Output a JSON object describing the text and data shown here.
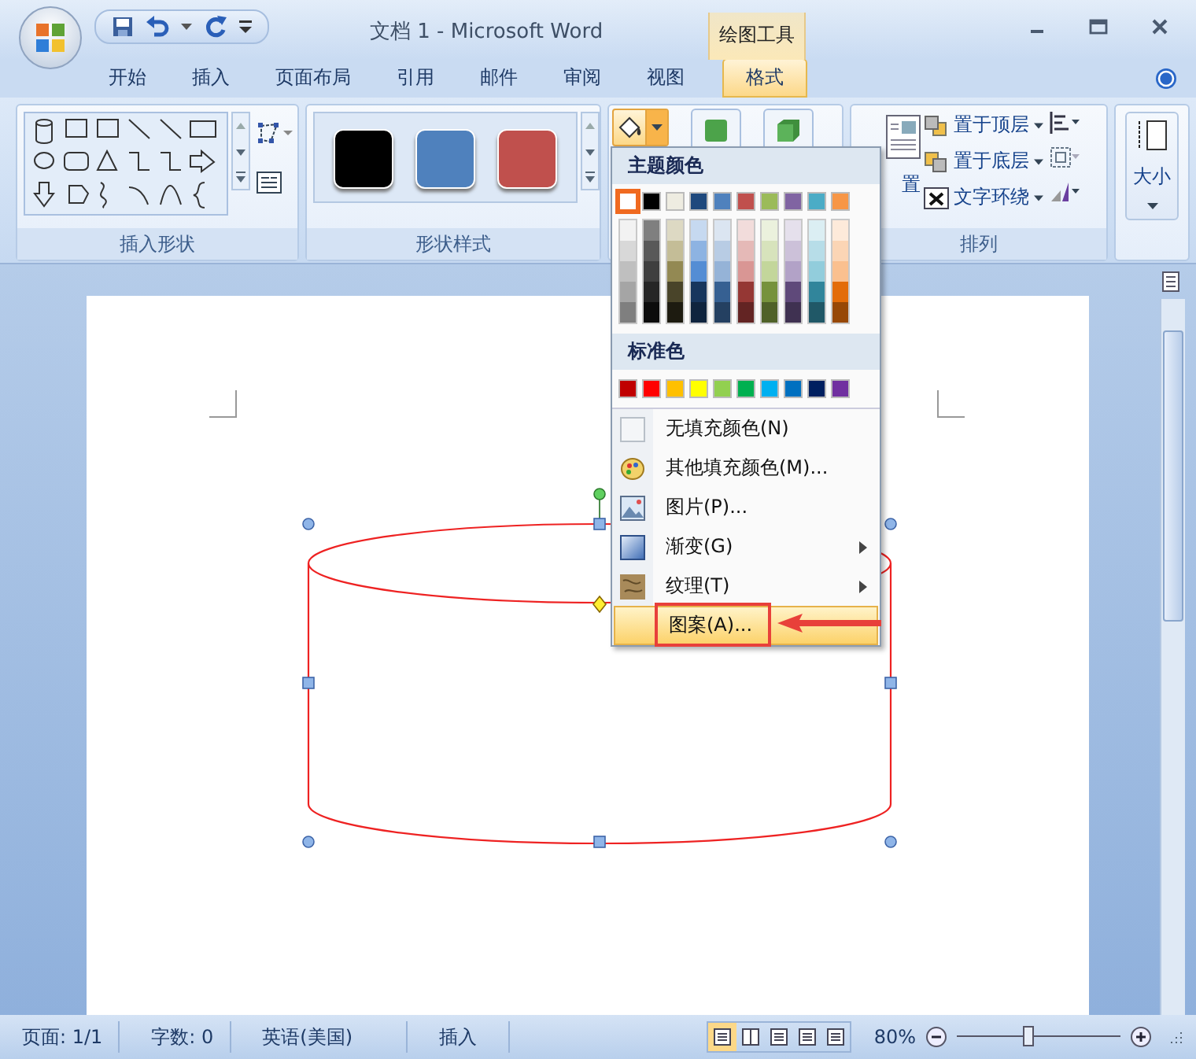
{
  "window": {
    "title": "文档 1 - Microsoft Word",
    "context_tab_group": "绘图工具"
  },
  "tabs": [
    {
      "label": "开始",
      "selected": false
    },
    {
      "label": "插入",
      "selected": false
    },
    {
      "label": "页面布局",
      "selected": false
    },
    {
      "label": "引用",
      "selected": false
    },
    {
      "label": "邮件",
      "selected": false
    },
    {
      "label": "审阅",
      "selected": false
    },
    {
      "label": "视图",
      "selected": false
    },
    {
      "label": "格式",
      "selected": true
    }
  ],
  "ribbon": {
    "insert_shapes": {
      "label": "插入形状"
    },
    "shape_styles": {
      "label": "形状样式",
      "swatches": [
        {
          "color": "#000000"
        },
        {
          "color": "#4f81bd"
        },
        {
          "color": "#c0504d"
        }
      ]
    },
    "arrange": {
      "label": "排列",
      "position_label": "置",
      "commands": [
        {
          "label": "置于顶层"
        },
        {
          "label": "置于底层"
        },
        {
          "label": "文字环绕"
        }
      ]
    },
    "size": {
      "label": "大小"
    }
  },
  "fill_menu": {
    "theme_header": "主题颜色",
    "theme_colors": [
      {
        "color": "#ffffff",
        "selected": true,
        "shades": [
          {
            "color": "#f2f2f2"
          },
          {
            "color": "#d8d8d8"
          },
          {
            "color": "#bfbfbf"
          },
          {
            "color": "#a5a5a5"
          },
          {
            "color": "#7f7f7f"
          }
        ]
      },
      {
        "color": "#000000",
        "selected": false,
        "shades": [
          {
            "color": "#7f7f7f"
          },
          {
            "color": "#595959"
          },
          {
            "color": "#3f3f3f"
          },
          {
            "color": "#262626"
          },
          {
            "color": "#0c0c0c"
          }
        ]
      },
      {
        "color": "#eeece1",
        "selected": false,
        "shades": [
          {
            "color": "#ddd9c3"
          },
          {
            "color": "#c4bd97"
          },
          {
            "color": "#938953"
          },
          {
            "color": "#494429"
          },
          {
            "color": "#1d1b10"
          }
        ]
      },
      {
        "color": "#1f497d",
        "selected": false,
        "shades": [
          {
            "color": "#c6d9f0"
          },
          {
            "color": "#8db3e2"
          },
          {
            "color": "#548dd4"
          },
          {
            "color": "#17365d"
          },
          {
            "color": "#0f243e"
          }
        ]
      },
      {
        "color": "#4f81bd",
        "selected": false,
        "shades": [
          {
            "color": "#dbe5f1"
          },
          {
            "color": "#b8cce4"
          },
          {
            "color": "#95b3d7"
          },
          {
            "color": "#366092"
          },
          {
            "color": "#244061"
          }
        ]
      },
      {
        "color": "#c0504d",
        "selected": false,
        "shades": [
          {
            "color": "#f2dcdb"
          },
          {
            "color": "#e5b9b7"
          },
          {
            "color": "#d99694"
          },
          {
            "color": "#953734"
          },
          {
            "color": "#632423"
          }
        ]
      },
      {
        "color": "#9bbb59",
        "selected": false,
        "shades": [
          {
            "color": "#ebf1dd"
          },
          {
            "color": "#d7e3bc"
          },
          {
            "color": "#c3d69b"
          },
          {
            "color": "#76923c"
          },
          {
            "color": "#4f6128"
          }
        ]
      },
      {
        "color": "#8064a2",
        "selected": false,
        "shades": [
          {
            "color": "#e5e0ec"
          },
          {
            "color": "#ccc1d9"
          },
          {
            "color": "#b2a2c7"
          },
          {
            "color": "#5f497a"
          },
          {
            "color": "#3f3151"
          }
        ]
      },
      {
        "color": "#4bacc6",
        "selected": false,
        "shades": [
          {
            "color": "#dbeef3"
          },
          {
            "color": "#b7dde8"
          },
          {
            "color": "#92cddc"
          },
          {
            "color": "#31859b"
          },
          {
            "color": "#205867"
          }
        ]
      },
      {
        "color": "#f79646",
        "selected": false,
        "shades": [
          {
            "color": "#fdeada"
          },
          {
            "color": "#fbd5b5"
          },
          {
            "color": "#fac08f"
          },
          {
            "color": "#e36c09"
          },
          {
            "color": "#974806"
          }
        ]
      }
    ],
    "standard_header": "标准色",
    "standard_colors": [
      {
        "color": "#c00000"
      },
      {
        "color": "#ff0000"
      },
      {
        "color": "#ffc000"
      },
      {
        "color": "#ffff00"
      },
      {
        "color": "#92d050"
      },
      {
        "color": "#00b050"
      },
      {
        "color": "#00b0f0"
      },
      {
        "color": "#0070c0"
      },
      {
        "color": "#002060"
      },
      {
        "color": "#7030a0"
      }
    ],
    "items": [
      {
        "label": "无填充颜色(N)",
        "kind": "none",
        "selected": false
      },
      {
        "label": "其他填充颜色(M)...",
        "kind": "palette",
        "selected": false
      },
      {
        "label": "图片(P)...",
        "kind": "picture",
        "selected": false
      },
      {
        "label": "渐变(G)",
        "kind": "gradient",
        "selected": false,
        "submenu": true
      },
      {
        "label": "纹理(T)",
        "kind": "texture",
        "selected": false,
        "submenu": true
      },
      {
        "label": "图案(A)...",
        "kind": "pattern",
        "selected": true
      }
    ]
  },
  "status_bar": {
    "page": "页面: 1/1",
    "words": "字数: 0",
    "language": "英语(美国)",
    "mode": "插入",
    "zoom": "80%",
    "views": [
      {
        "selected": true
      },
      {
        "selected": false
      },
      {
        "selected": false
      },
      {
        "selected": false
      },
      {
        "selected": false
      }
    ],
    "zoom_slider": {
      "level": 0.43
    }
  }
}
